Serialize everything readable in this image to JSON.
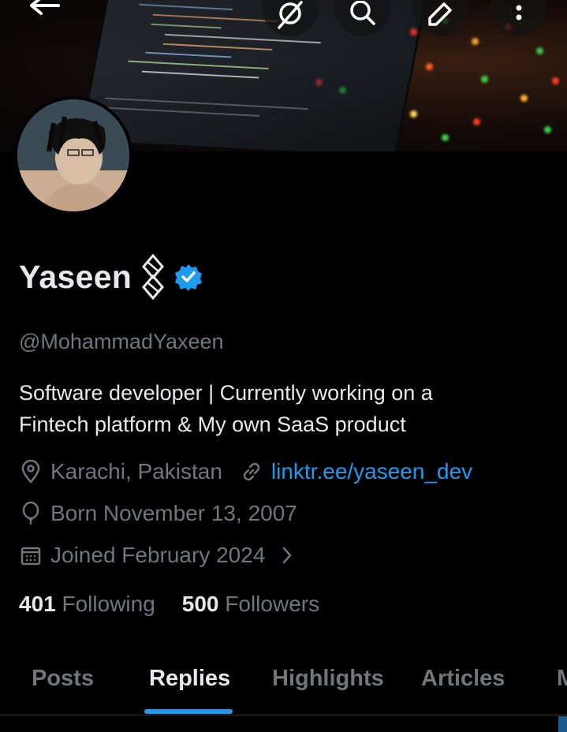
{
  "profile": {
    "name": "Yaseen",
    "handle": "@MohammadYaxeen",
    "bio_line1": "Software developer | Currently working on a",
    "bio_line2": "Fintech platform & My own SaaS product",
    "location": "Karachi, Pakistan",
    "website": "linktr.ee/yaseen_dev",
    "birthday": "Born November 13, 2007",
    "joined": "Joined February 2024",
    "verified": true
  },
  "stats": {
    "following_count": "401",
    "following_label": "Following",
    "followers_count": "500",
    "followers_label": "Followers"
  },
  "tabs": [
    {
      "label": "Posts",
      "active": false
    },
    {
      "label": "Replies",
      "active": true
    },
    {
      "label": "Highlights",
      "active": false
    },
    {
      "label": "Articles",
      "active": false
    },
    {
      "label": "M",
      "active": false
    }
  ],
  "icons": {
    "back": "arrow-left-icon",
    "grok": "grok-icon",
    "search": "search-icon",
    "compose": "edit-icon",
    "more": "more-vertical-icon",
    "verified": "verified-badge-icon",
    "emoji": "chain-glyph-icon",
    "location": "location-pin-icon",
    "link": "link-icon",
    "birthday": "balloon-icon",
    "calendar": "calendar-icon",
    "chevron": "chevron-right-icon"
  },
  "colors": {
    "background": "#000000",
    "primary_text": "#e7e9ea",
    "secondary_text": "#71767b",
    "accent": "#1d9bf0"
  }
}
